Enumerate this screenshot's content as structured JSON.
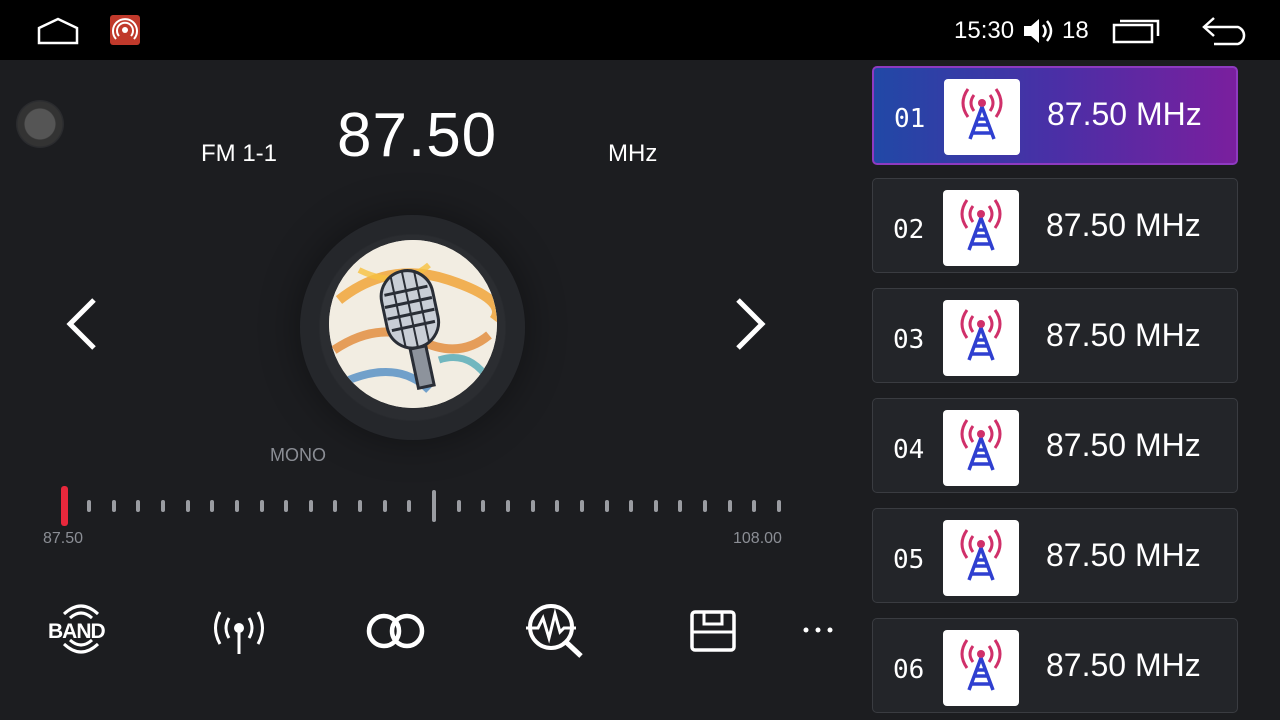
{
  "status_bar": {
    "time": "15:30",
    "volume": "18",
    "icons": {
      "home": "home-icon",
      "app": "radio-app-icon",
      "volume": "volume-icon",
      "recents": "recent-apps-icon",
      "back": "back-arrow-icon"
    }
  },
  "tuner": {
    "band_label": "FM 1-1",
    "frequency": "87.50",
    "unit": "MHz",
    "mode": "MONO",
    "scale_min": "87.50",
    "scale_max": "108.00",
    "tuning_position": 0.0
  },
  "controls": [
    {
      "label": "BAND",
      "icon": "band-icon"
    },
    {
      "icon": "antenna-icon"
    },
    {
      "icon": "stereo-icon"
    },
    {
      "icon": "scan-search-icon"
    },
    {
      "icon": "save-icon"
    },
    {
      "icon": "more-icon"
    }
  ],
  "presets": [
    {
      "number": "01",
      "frequency": "87.50 MHz",
      "active": true
    },
    {
      "number": "02",
      "frequency": "87.50 MHz",
      "active": false
    },
    {
      "number": "03",
      "frequency": "87.50 MHz",
      "active": false
    },
    {
      "number": "04",
      "frequency": "87.50 MHz",
      "active": false
    },
    {
      "number": "05",
      "frequency": "87.50 MHz",
      "active": false
    },
    {
      "number": "06",
      "frequency": "87.50 MHz",
      "active": false
    }
  ],
  "colors": {
    "background": "#1c1d20",
    "active_preset_start": "#2148a6",
    "active_preset_end": "#7a1f9e",
    "tuning_needle": "#e8283c",
    "app_icon": "#c0392b"
  }
}
